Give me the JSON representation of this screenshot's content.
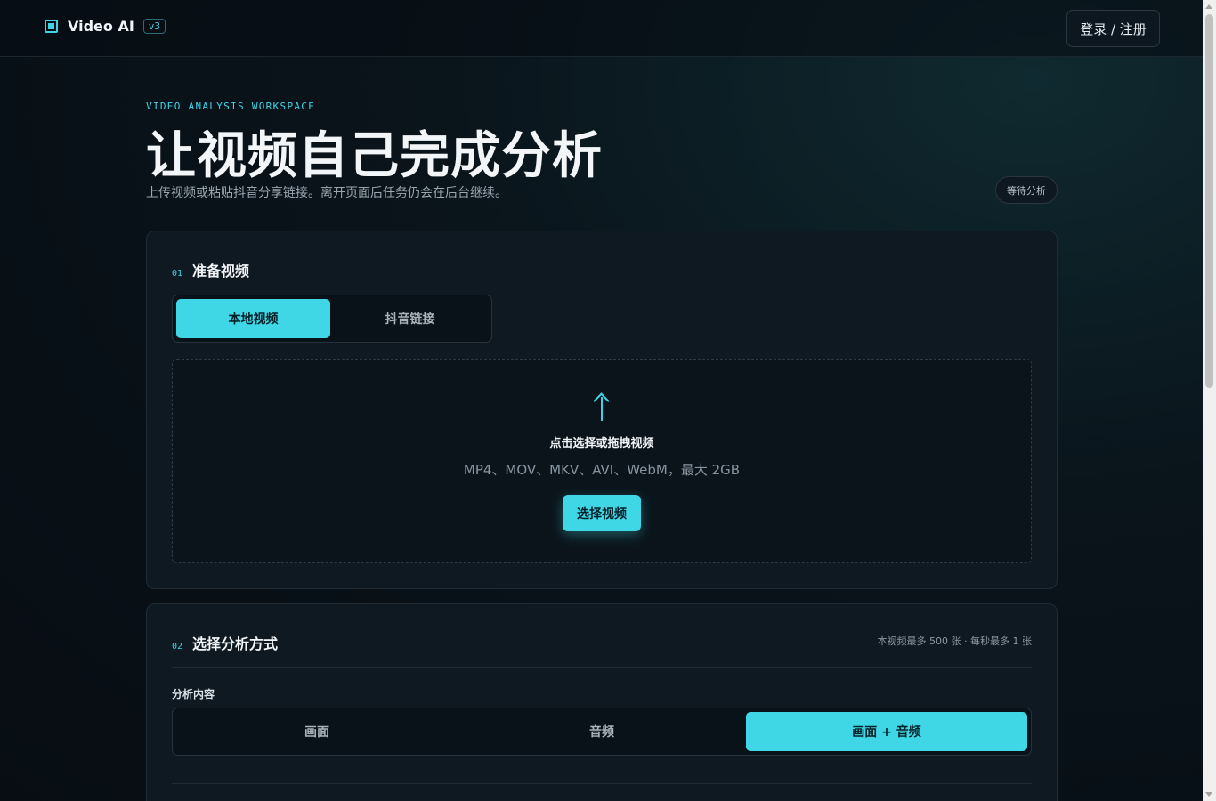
{
  "header": {
    "brand_name": "Video AI",
    "version_badge": "v3",
    "login_label": "登录 / 注册"
  },
  "hero": {
    "eyebrow": "VIDEO ANALYSIS WORKSPACE",
    "title": "让视频自己完成分析",
    "subtitle": "上传视频或粘贴抖音分享链接。离开页面后任务仍会在后台继续。",
    "status": "等待分析"
  },
  "step1": {
    "number": "01",
    "title": "准备视频",
    "tabs": [
      {
        "label": "本地视频",
        "active": true
      },
      {
        "label": "抖音链接",
        "active": false
      }
    ],
    "dropzone": {
      "title": "点击选择或拖拽视频",
      "hint": "MP4、MOV、MKV、AVI、WebM，最大 2GB",
      "button": "选择视频"
    }
  },
  "step2": {
    "number": "02",
    "title": "选择分析方式",
    "limit_note": "本视频最多 500 张 · 每秒最多 1 张",
    "content_label": "分析内容",
    "options": [
      {
        "label": "画面",
        "active": false
      },
      {
        "label": "音频",
        "active": false
      },
      {
        "label": "画面 + 音频",
        "active": true
      }
    ]
  },
  "colors": {
    "accent": "#3fd6e6",
    "background": "#070d13",
    "card": "#0e1922"
  }
}
